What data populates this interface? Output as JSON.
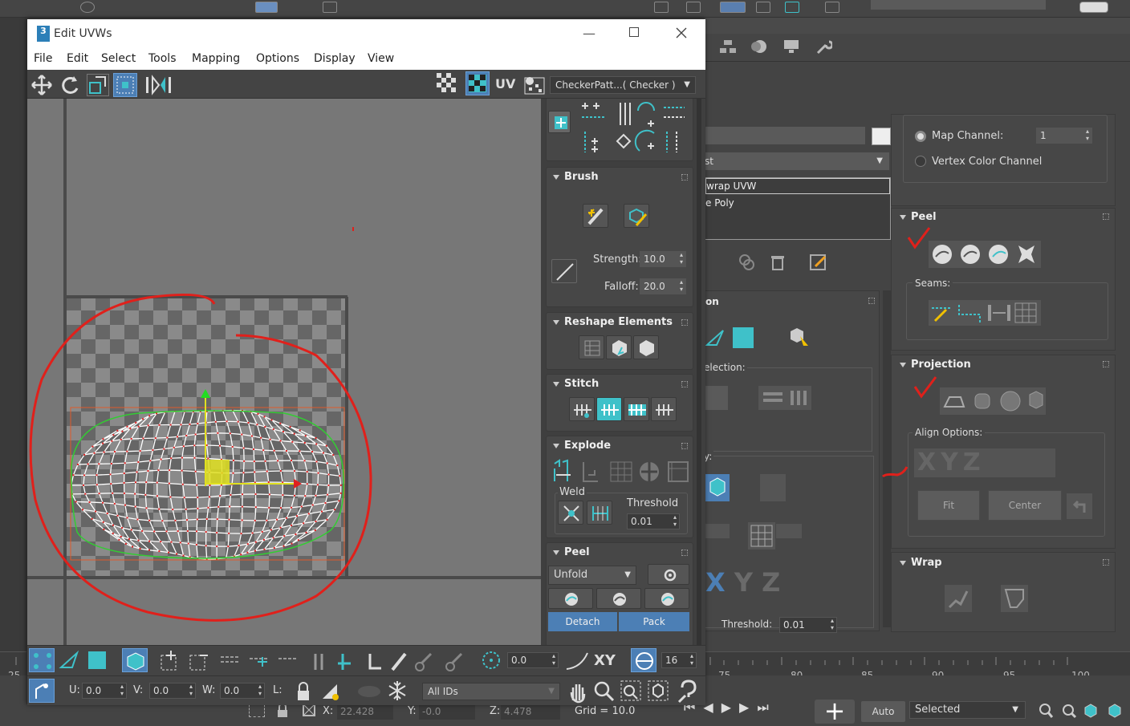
{
  "window": {
    "title": "Edit UVWs",
    "app_icon": "3",
    "menus": [
      "File",
      "Edit",
      "Select",
      "Tools",
      "Mapping",
      "Options",
      "Display",
      "View"
    ],
    "uv_label": "UV",
    "texture_dropdown": "CheckerPatt...( Checker )"
  },
  "side": {
    "brush": {
      "title": "Brush",
      "strength_label": "Strength:",
      "strength": "10.0",
      "falloff_label": "Falloff:",
      "falloff": "20.0"
    },
    "reshape": {
      "title": "Reshape Elements"
    },
    "stitch": {
      "title": "Stitch"
    },
    "explode": {
      "title": "Explode",
      "weld_label": "Weld",
      "threshold_label": "Threshold",
      "threshold": "0.01"
    },
    "peel": {
      "title": "Peel",
      "mode": "Unfold",
      "detach": "Detach",
      "pack": "Pack"
    }
  },
  "bottom": {
    "rotate_value": "0.0",
    "xy_label": "XY",
    "snap_value": "16",
    "u_label": "U:",
    "u": "0.0",
    "v_label": "V:",
    "v": "0.0",
    "w_label": "W:",
    "w": "0.0",
    "l_label": "L:",
    "ids": "All IDs"
  },
  "cmd": {
    "map_channel_label": "Map Channel:",
    "map_channel": "1",
    "vertex_color_label": "Vertex Color Channel",
    "modifier_dropdown": "st",
    "stack": [
      "wrap UVW",
      "e Poly"
    ],
    "peel_title": "Peel",
    "seams_label": "Seams:",
    "projection_title": "Projection",
    "align_label": "Align Options:",
    "fit": "Fit",
    "center": "Center",
    "wrap_title": "Wrap",
    "selection_title": "on",
    "selection_label": "election:",
    "by_label": "y:",
    "threshold_label": "Threshold:",
    "threshold": "0.01"
  },
  "timeline": {
    "ticks": [
      "25",
      "75",
      "80",
      "85",
      "90",
      "95",
      "100"
    ]
  },
  "status": {
    "x_label": "X:",
    "x": "22.428",
    "y_label": "Y:",
    "y": "-0.0",
    "z_label": "Z:",
    "z": "4.478",
    "grid": "Grid = 10.0",
    "auto": "Auto",
    "selected": "Selected"
  },
  "colors": {
    "accent": "#4c7fb5",
    "teal": "#3fc1c9",
    "annotation": "#e0201b",
    "wire": "#ffffff",
    "select_box": "#e05a2b",
    "gizmo": "#ffff00"
  }
}
